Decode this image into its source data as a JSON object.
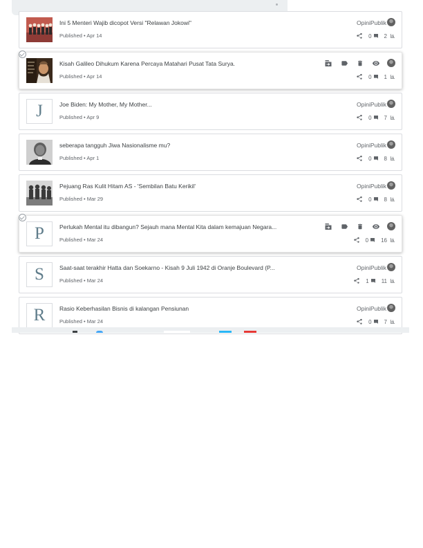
{
  "posts": [
    {
      "title": "Ini 5 Menteri Wajib dicopot Versi \"Relawan Jokowi\"",
      "status": "Published",
      "date": "Apr 14",
      "blog": "OpiniPublik",
      "comments": "0",
      "views": "2",
      "thumb": "photo",
      "thumb_icon": "men-lineup-photo",
      "selected": false,
      "hovered": false
    },
    {
      "title": "Kisah Galileo Dihukum Karena Percaya Matahari Pusat Tata Surya.",
      "status": "Published",
      "date": "Apr 14",
      "blog": "",
      "comments": "0",
      "views": "1",
      "thumb": "photo",
      "thumb_icon": "galileo-portrait-photo",
      "selected": true,
      "hovered": true
    },
    {
      "title": "Joe Biden: My Mother, My Mother...",
      "status": "Published",
      "date": "Apr 9",
      "blog": "OpiniPublik",
      "comments": "0",
      "views": "7",
      "thumb": "letter",
      "letter": "J",
      "selected": false,
      "hovered": false
    },
    {
      "title": "seberapa tangguh Jiwa Nasionalisme mu?",
      "status": "Published",
      "date": "Apr 1",
      "blog": "OpiniPublik",
      "comments": "0",
      "views": "8",
      "thumb": "photo",
      "thumb_icon": "portrait-bw-photo",
      "selected": false,
      "hovered": false
    },
    {
      "title": "Pejuang Ras Kulit Hitam AS - 'Sembilan Batu Kerikil'",
      "status": "Published",
      "date": "Mar 29",
      "blog": "OpiniPublik",
      "comments": "0",
      "views": "8",
      "thumb": "photo",
      "thumb_icon": "group-bw-photo",
      "selected": false,
      "hovered": false
    },
    {
      "title": "Perlukah Mental itu dibangun? Sejauh mana Mental Kita dalam kemajuan Negara...",
      "status": "Published",
      "date": "Mar 24",
      "blog": "",
      "comments": "0",
      "views": "16",
      "thumb": "letter",
      "letter": "P",
      "selected": true,
      "hovered": true
    },
    {
      "title": "Saat-saat terakhir Hatta dan Soekarno - Kisah 9 Juli 1942 di Oranje Boulevard (P...",
      "status": "Published",
      "date": "Mar 24",
      "blog": "OpiniPublik",
      "comments": "1",
      "views": "11",
      "thumb": "letter",
      "letter": "S",
      "selected": false,
      "hovered": false
    },
    {
      "title": "Rasio Keberhasilan Bisnis di kalangan Pensiunan",
      "status": "Published",
      "date": "Mar 24",
      "blog": "OpiniPublik",
      "comments": "0",
      "views": "7",
      "thumb": "letter",
      "letter": "R",
      "selected": false,
      "hovered": false
    }
  ],
  "separator": " • ",
  "action_icons": [
    "move-to-blog-icon",
    "label-icon",
    "delete-icon",
    "view-icon"
  ],
  "colors": {
    "border": "#dadce0",
    "icon": "#5f6368",
    "letter": "#607d8b",
    "strip": "#eceff1"
  }
}
